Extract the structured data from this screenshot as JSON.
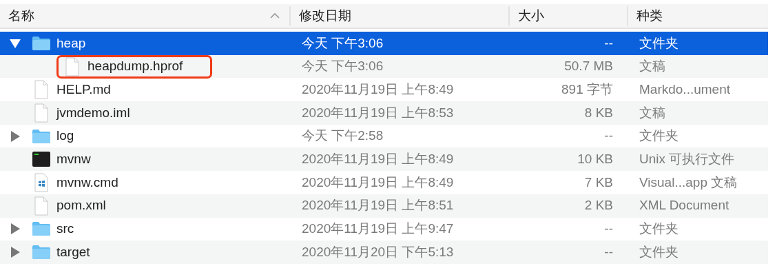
{
  "columns": [
    {
      "label": "名称",
      "sorted": true
    },
    {
      "label": "修改日期",
      "sorted": false
    },
    {
      "label": "大小",
      "sorted": false
    },
    {
      "label": "种类",
      "sorted": false
    }
  ],
  "rows": [
    {
      "name": "heap",
      "kind": "folder",
      "expanded": true,
      "selected": true,
      "highlighted": false,
      "date": "今天 下午3:06",
      "size": "--",
      "type": "文件夹",
      "children": [
        {
          "name": "heapdump.hprof",
          "kind": "document",
          "selected": false,
          "highlighted": true,
          "date": "今天 下午3:06",
          "size": "50.7 MB",
          "type": "文稿"
        }
      ]
    },
    {
      "name": "HELP.md",
      "kind": "document",
      "selected": false,
      "highlighted": false,
      "date": "2020年11月19日 上午8:49",
      "size": "891 字节",
      "type": "Markdo...ument"
    },
    {
      "name": "jvmdemo.iml",
      "kind": "document",
      "selected": false,
      "highlighted": false,
      "date": "2020年11月19日 上午8:53",
      "size": "8 KB",
      "type": "文稿"
    },
    {
      "name": "log",
      "kind": "folder",
      "expanded": false,
      "selected": false,
      "highlighted": false,
      "date": "今天 下午2:58",
      "size": "--",
      "type": "文件夹"
    },
    {
      "name": "mvnw",
      "kind": "terminal",
      "selected": false,
      "highlighted": false,
      "date": "2020年11月19日 上午8:49",
      "size": "10 KB",
      "type": "Unix 可执行文件"
    },
    {
      "name": "mvnw.cmd",
      "kind": "windows",
      "selected": false,
      "highlighted": false,
      "date": "2020年11月19日 上午8:49",
      "size": "7 KB",
      "type": "Visual...app 文稿"
    },
    {
      "name": "pom.xml",
      "kind": "document",
      "selected": false,
      "highlighted": false,
      "date": "2020年11月19日 上午8:51",
      "size": "2 KB",
      "type": "XML Document"
    },
    {
      "name": "src",
      "kind": "folder",
      "expanded": false,
      "selected": false,
      "highlighted": false,
      "date": "2020年11月19日 上午9:47",
      "size": "--",
      "type": "文件夹"
    },
    {
      "name": "target",
      "kind": "folder",
      "expanded": false,
      "selected": false,
      "highlighted": false,
      "date": "2020年11月20日 下午5:13",
      "size": "--",
      "type": "文件夹"
    }
  ]
}
